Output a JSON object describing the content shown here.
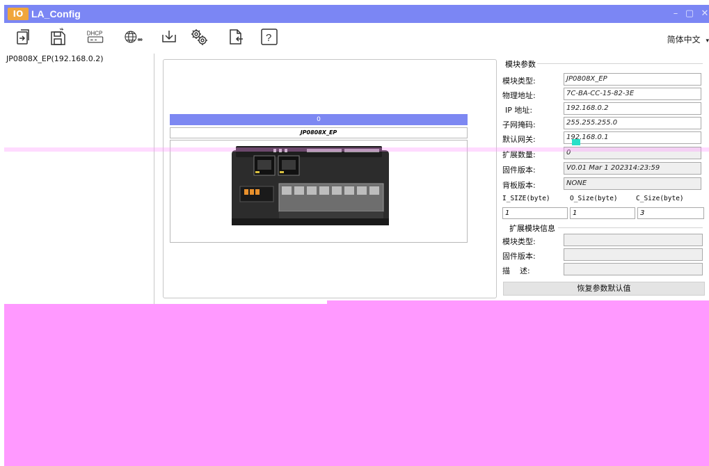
{
  "window": {
    "logo": "IO",
    "title": "LA_Config",
    "minimize": "–",
    "maximize": "▢",
    "close": "✕"
  },
  "toolbar": {
    "dhcp_label": "DHCP",
    "language": "简体中文"
  },
  "tree": {
    "items": [
      {
        "label": "JP0808X_EP(192.168.0.2)"
      }
    ]
  },
  "module_view": {
    "slot_index": "0",
    "slot_name": "JP0808X_EP"
  },
  "params": {
    "group_title": "模块参数",
    "fields": [
      {
        "label": "模块类型:",
        "value": "JP0808X_EP"
      },
      {
        "label": "物理地址:",
        "value": "7C-BA-CC-15-82-3E"
      },
      {
        "label": "IP 地址:",
        "value": "192.168.0.2"
      },
      {
        "label": "子网掩码:",
        "value": "255.255.255.0"
      },
      {
        "label": "默认网关:",
        "value": "192.168.0.1"
      },
      {
        "label": "扩展数量:",
        "value": "0"
      },
      {
        "label": "固件版本:",
        "value": "V0.01 Mar  1 202314:23:59"
      },
      {
        "label": "背板版本:",
        "value": "NONE"
      }
    ],
    "size_headers": {
      "i_size": "I_SIZE(byte)",
      "o_size": "O_Size(byte)",
      "c_size": "C_Size(byte)"
    },
    "size_values": {
      "i_size": "1",
      "o_size": "1",
      "c_size": "3"
    },
    "ext_group_title": "扩展模块信息",
    "ext_fields": [
      {
        "label": "模块类型:",
        "value": ""
      },
      {
        "label": "固件版本:",
        "value": ""
      },
      {
        "label": "描    述:",
        "value": ""
      }
    ],
    "restore_button": "恢复参数默认值"
  },
  "colors": {
    "titlebar": "#7b86f4",
    "logo": "#f0a63c",
    "overlay": "#ff99ff",
    "slot_bar": "#7d88f2"
  }
}
